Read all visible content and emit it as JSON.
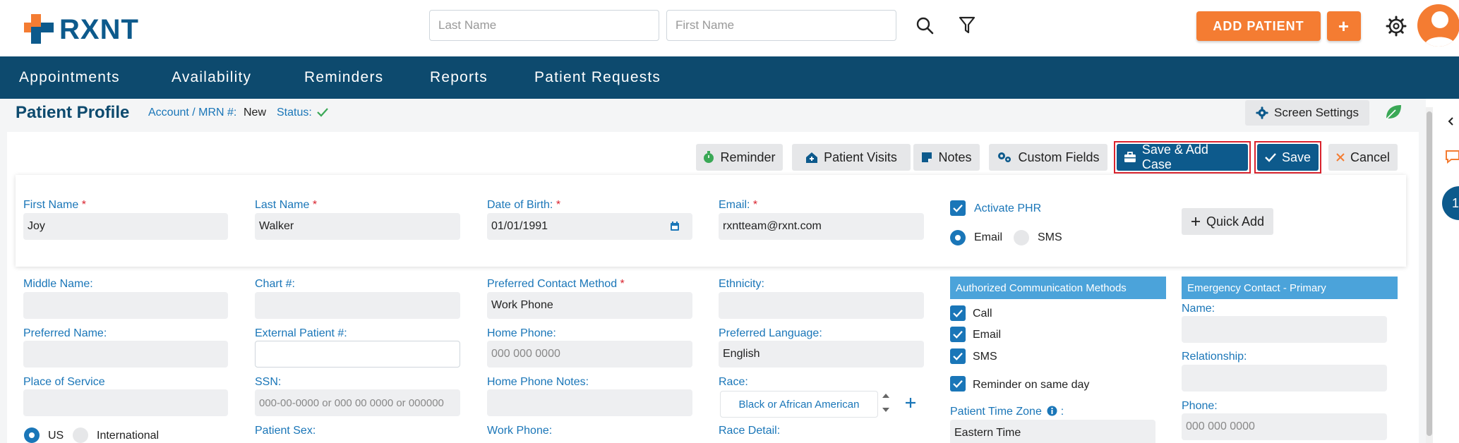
{
  "app": {
    "brand": "RXNT"
  },
  "header": {
    "last_name_placeholder": "Last Name",
    "first_name_placeholder": "First Name",
    "add_patient_label": "ADD PATIENT",
    "add_plus_label": "+"
  },
  "nav": {
    "items": [
      "Appointments",
      "Availability",
      "Reminders",
      "Reports",
      "Patient Requests"
    ]
  },
  "page": {
    "title": "Patient Profile",
    "account_label": "Account / MRN #:",
    "account_value": "New",
    "status_label": "Status:",
    "screen_settings_label": "Screen Settings"
  },
  "toolbar": {
    "reminder": "Reminder",
    "patient_visits": "Patient Visits",
    "notes": "Notes",
    "custom_fields": "Custom Fields",
    "save_add_case": "Save & Add Case",
    "save": "Save",
    "cancel": "Cancel"
  },
  "primary": {
    "first_name_label": "First Name",
    "first_name_value": "Joy",
    "last_name_label": "Last Name",
    "last_name_value": "Walker",
    "dob_label": "Date of Birth:",
    "dob_value": "01/01/1991",
    "email_label": "Email:",
    "email_value": "rxntteam@rxnt.com",
    "activate_phr_label": "Activate PHR",
    "phr_email_label": "Email",
    "phr_sms_label": "SMS",
    "quick_add_label": "Quick Add"
  },
  "details": {
    "middle_name_label": "Middle Name:",
    "chart_label": "Chart #:",
    "preferred_contact_label": "Preferred Contact Method",
    "preferred_contact_value": "Work Phone",
    "ethnicity_label": "Ethnicity:",
    "preferred_name_label": "Preferred Name:",
    "external_patient_label": "External Patient #:",
    "home_phone_label": "Home Phone:",
    "home_phone_placeholder": "000 000 0000",
    "preferred_language_label": "Preferred Language:",
    "preferred_language_value": "English",
    "place_of_service_label": "Place of Service",
    "ssn_label": "SSN:",
    "ssn_placeholder": "000-00-0000 or 000 00 0000 or 000000",
    "home_phone_notes_label": "Home Phone Notes:",
    "race_label": "Race:",
    "race_value": "Black or African American",
    "us_label": "US",
    "international_label": "International",
    "patient_sex_label": "Patient Sex:",
    "work_phone_label": "Work Phone:",
    "race_detail_label": "Race Detail:"
  },
  "communication": {
    "title": "Authorized Communication Methods",
    "call": "Call",
    "email": "Email",
    "sms": "SMS",
    "reminder_same_day": "Reminder on same day",
    "time_zone_label": "Patient Time Zone",
    "time_zone_value": "Eastern Time"
  },
  "emergency": {
    "title": "Emergency Contact - Primary",
    "name_label": "Name:",
    "relationship_label": "Relationship:",
    "phone_label": "Phone:",
    "phone_placeholder": "000 000 0000"
  },
  "rail": {
    "badge": "1"
  },
  "colors": {
    "brand_blue": "#0d5a8c",
    "nav_bg": "#0d4a6e",
    "accent_orange": "#f47c32",
    "link_blue": "#1a76b8",
    "required_red": "#d9232e"
  }
}
